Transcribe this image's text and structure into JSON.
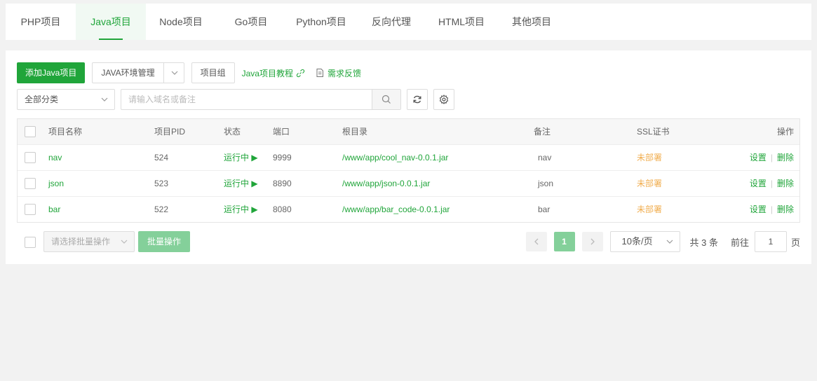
{
  "tabs": [
    {
      "label": "PHP项目"
    },
    {
      "label": "Java项目"
    },
    {
      "label": "Node项目"
    },
    {
      "label": "Go项目"
    },
    {
      "label": "Python项目"
    },
    {
      "label": "反向代理"
    },
    {
      "label": "HTML项目"
    },
    {
      "label": "其他项目"
    }
  ],
  "active_tab": "Java项目",
  "toolbar": {
    "add_label": "添加Java项目",
    "env_label": "JAVA环境管理",
    "group_label": "项目组",
    "tutorial_label": "Java项目教程",
    "feedback_label": "需求反馈"
  },
  "filter": {
    "category": "全部分类",
    "search_placeholder": "请输入域名或备注"
  },
  "table": {
    "headers": {
      "name": "项目名称",
      "pid": "项目PID",
      "status": "状态",
      "port": "端口",
      "root": "根目录",
      "remark": "备注",
      "ssl": "SSL证书",
      "ops": "操作"
    },
    "rows": [
      {
        "name": "nav",
        "pid": "524",
        "status": "运行中 ▶",
        "port": "9999",
        "root": "/www/app/cool_nav-0.0.1.jar",
        "remark": "nav",
        "ssl": "未部署",
        "set": "设置",
        "del": "删除"
      },
      {
        "name": "json",
        "pid": "523",
        "status": "运行中 ▶",
        "port": "8890",
        "root": "/www/app/json-0.0.1.jar",
        "remark": "json",
        "ssl": "未部署",
        "set": "设置",
        "del": "删除"
      },
      {
        "name": "bar",
        "pid": "522",
        "status": "运行中 ▶",
        "port": "8080",
        "root": "/www/app/bar_code-0.0.1.jar",
        "remark": "bar",
        "ssl": "未部署",
        "set": "设置",
        "del": "删除"
      }
    ]
  },
  "footer": {
    "batch_select": "请选择批量操作",
    "batch_button": "批量操作",
    "current_page": "1",
    "page_size": "10条/页",
    "total": "共 3 条",
    "goto_prefix": "前往",
    "goto_value": "1",
    "goto_suffix": "页"
  },
  "colors": {
    "accent": "#20a53a",
    "warning": "#f0ad4e"
  }
}
